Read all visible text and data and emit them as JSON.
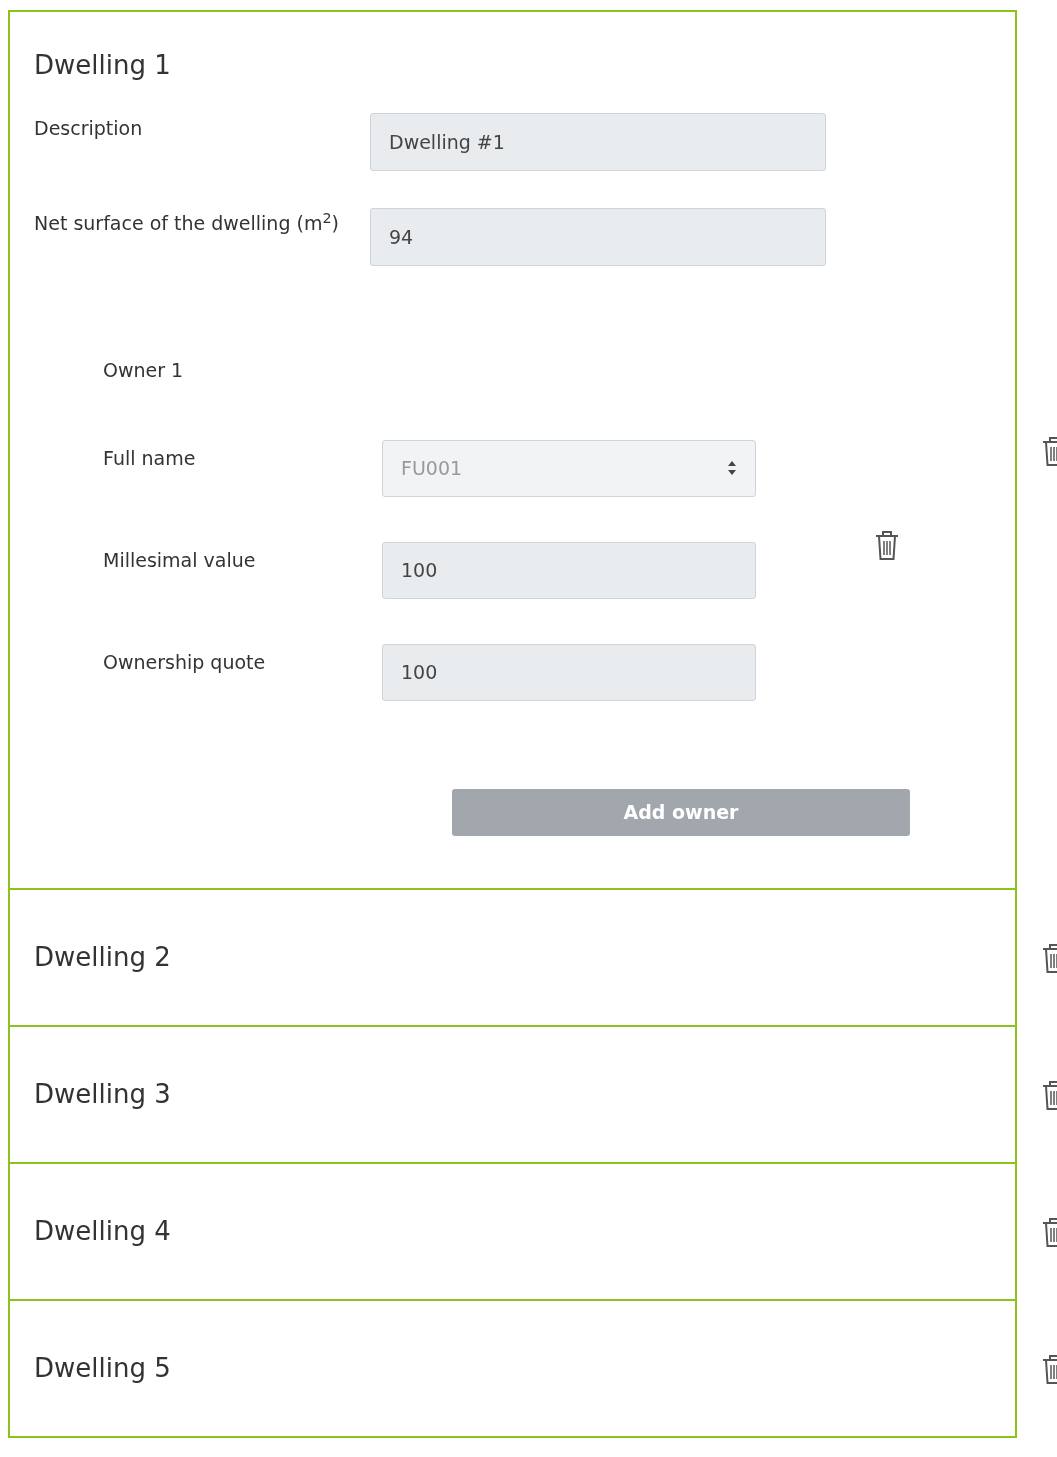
{
  "dwellings": [
    {
      "title": "Dwelling 1",
      "expanded": true,
      "fields": [
        {
          "label": "Description",
          "value": "Dwelling #1"
        },
        {
          "label": "Net surface of the dwelling (m$^{2}$)",
          "value": "94"
        }
      ],
      "owners": [
        {
          "title": "Owner 1",
          "fields": [
            {
              "label": "Full name",
              "kind": "select",
              "value": "FU001",
              "disabled": true
            },
            {
              "label": "Millesimal value",
              "kind": "text",
              "value": "100",
              "disabled": false
            },
            {
              "label": "Ownership quote",
              "kind": "text",
              "value": "100",
              "disabled": false
            }
          ]
        }
      ],
      "add_button": "Add owner"
    },
    {
      "title": "Dwelling 2",
      "expanded": false
    },
    {
      "title": "Dwelling 3",
      "expanded": false
    },
    {
      "title": "Dwelling 4",
      "expanded": false
    },
    {
      "title": "Dwelling 5",
      "expanded": false
    }
  ]
}
